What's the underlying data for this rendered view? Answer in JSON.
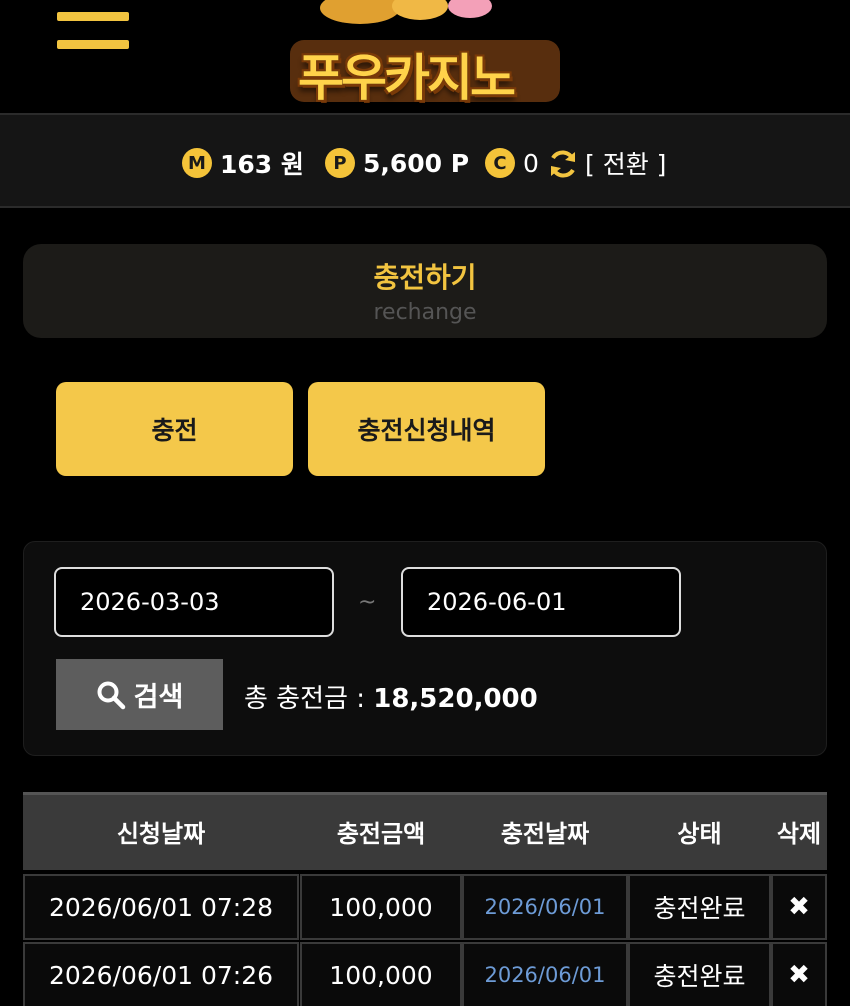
{
  "header": {
    "logo_text": "푸우카지노"
  },
  "balances": {
    "money": {
      "icon": "M",
      "value": "163 원"
    },
    "point": {
      "icon": "P",
      "value": "5,600 P"
    },
    "comp": {
      "icon": "C",
      "value": "0"
    },
    "convert_label": "[ 전환 ]"
  },
  "section": {
    "title": "충전하기",
    "subtitle": "rechange"
  },
  "tabs": {
    "charge": "충전",
    "history": "충전신청내역"
  },
  "search": {
    "date_from": "2026-03-03",
    "separator": "~",
    "date_to": "2026-06-01",
    "button_label": "검색",
    "total_label": "총 충전금 : ",
    "total_value": "18,520,000"
  },
  "table": {
    "columns": [
      "신청날짜",
      "충전금액",
      "충전날짜",
      "상태",
      "삭제"
    ],
    "rows": [
      {
        "request_date": "2026/06/01 07:28",
        "amount": "100,000",
        "charge_date": "2026/06/01",
        "status": "충전완료",
        "delete": "✖"
      },
      {
        "request_date": "2026/06/01 07:26",
        "amount": "100,000",
        "charge_date": "2026/06/01",
        "status": "충전완료",
        "delete": "✖"
      }
    ]
  },
  "colors": {
    "accent": "#f4c84a",
    "background": "#000000",
    "link": "#6d9bd6"
  }
}
